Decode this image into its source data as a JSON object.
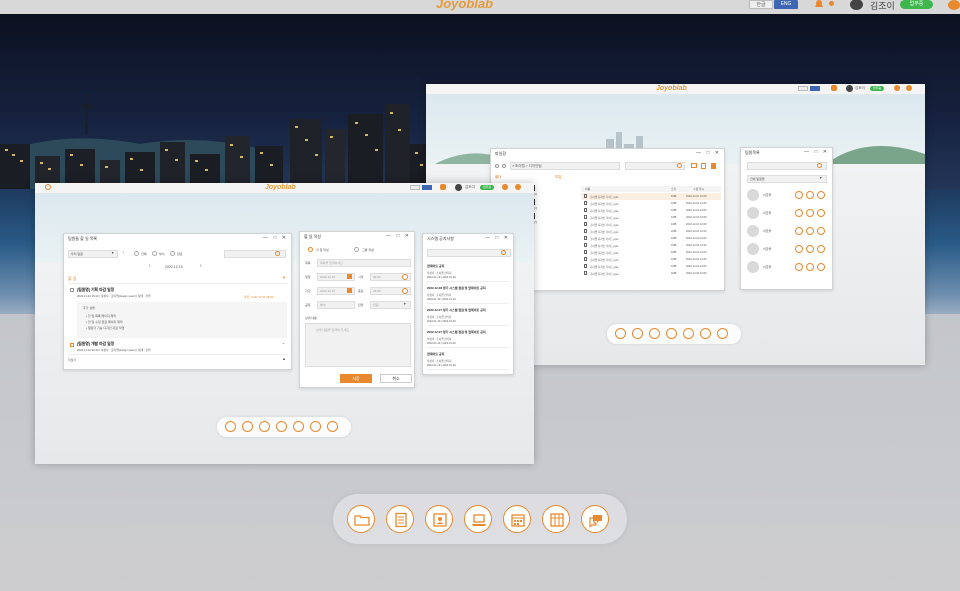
{
  "topbar": {
    "brand": "Joyoblab",
    "lang_ko": "한글",
    "lang_en": "ENG",
    "user_name": "김조이",
    "status": "업무중"
  },
  "colors": {
    "accent": "#e8892e",
    "status_green": "#3eb54d",
    "lang_active": "#3d67b4"
  },
  "dock": {
    "items": [
      "folder-icon",
      "document-list-icon",
      "contact-card-icon",
      "laptop-icon",
      "calendar-icon",
      "table-icon",
      "chat-bubbles-icon"
    ]
  },
  "left_window": {
    "brand": "Joyoblab",
    "user_name": "김조이",
    "status": "업무중",
    "schedule_panel": {
      "title": "팀원들 할 일 목록",
      "filter_value": "우리 팀원",
      "radio_all": "전체",
      "radio_mine": "부서",
      "radio_done": "완료",
      "date": "2022.12.15",
      "section_label": "할 일",
      "item1_title": "[팀원명] 기획 마감 일정",
      "item1_meta": "2022.11.23 15:23  |  작성자 : 조이랩(design team)  |  상태 : 진행",
      "item1_due": "마감 : 2022.12.31 18:00",
      "item1_body_title": "추가 설명",
      "item1_b1": "할 일 목록 페이지 제작",
      "item1_b2": "할 일 수정·완료 페이지 제작",
      "item1_b3": "캘린더 기능 디자인 자료 작업",
      "item2_title": "[팀원명] 개발 마감 일정",
      "item2_meta": "2022.11.24 10:30  |  작성자 : 조이랩(design team)  |  상태 : 진행",
      "footer_label": "더보기"
    },
    "add_task_panel": {
      "title": "할 일 작성",
      "tab_personal": "할 일 작성",
      "tab_team": "그룹 작성",
      "field_title_label": "제목",
      "field_title_placeholder": "제목을 입력하세요.",
      "start_label": "일정",
      "start_date": "2022-11-15",
      "start_time_label": "시작",
      "start_time": "09:00",
      "end_label": "기간",
      "end_date": "2022-11-15",
      "end_time_label": "종료",
      "end_time": "18:00",
      "share_label": "공유",
      "share_value": "부서",
      "assign_label": "담당",
      "assign_value": "전원",
      "detail_label": "상세 내용",
      "detail_placeholder": "상세 내용을 입력해 주세요.",
      "save": "저장",
      "cancel": "취소"
    },
    "notice_panel": {
      "title": "시스템 공지사항",
      "items": [
        {
          "title": "업데이트 공지",
          "sub": "작성자 : 조이랩 관리자",
          "date": "2022-01-19  |  2022-01-20"
        },
        {
          "title": "2022.12.28 정기 시스템 점검 및 업데이트 공지",
          "sub": "작성자 : 조이랩 관리자",
          "date": "2022-01-19  |  2022-01-20"
        },
        {
          "title": "2022.12.27 정기 시스템 점검 및 업데이트 공지",
          "sub": "작성자 : 조이랩 관리자",
          "date": "2022-01-19  |  2022-01-20"
        },
        {
          "title": "2022.12.27 정기 시스템 점검 및 업데이트 공지",
          "sub": "작성자 : 조이랩 관리자",
          "date": "2022-01-19  |  2022-01-20"
        },
        {
          "title": "업데이트 공지",
          "sub": "작성자 : 조이랩 관리자",
          "date": "2022-01-19  |  2022-01-20"
        }
      ]
    }
  },
  "right_window": {
    "brand": "Joyoblab",
    "user_name": "김조이",
    "status": "업무중",
    "files_panel": {
      "title": "파일함",
      "path": "> 조이랩 > 디자인팀",
      "folder_label": "폴더",
      "list_label": "파일",
      "col_name": "이름",
      "col_size": "크기",
      "col_date": "수정 일시",
      "files": [
        {
          "name": "조이랩 디자인 가이드.pptx",
          "size": "1MB",
          "date": "2022-12-01 12:00"
        },
        {
          "name": "조이랩 디자인 가이드.pptx",
          "size": "1MB",
          "date": "2022-12-01 12:00"
        },
        {
          "name": "조이랩 디자인 가이드.pptx",
          "size": "1MB",
          "date": "2022-12-01 12:00"
        },
        {
          "name": "조이랩 디자인 가이드.pptx",
          "size": "1MB",
          "date": "2022-12-01 12:00"
        },
        {
          "name": "조이랩 디자인 가이드.pptx",
          "size": "1MB",
          "date": "2022-12-01 12:00"
        },
        {
          "name": "조이랩 디자인 가이드.pptx",
          "size": "1MB",
          "date": "2022-12-01 12:00"
        },
        {
          "name": "조이랩 디자인 가이드.pptx",
          "size": "1MB",
          "date": "2022-12-01 12:00"
        },
        {
          "name": "조이랩 디자인 가이드.pptx",
          "size": "1MB",
          "date": "2022-12-01 12:00"
        },
        {
          "name": "조이랩 디자인 가이드.pptx",
          "size": "1MB",
          "date": "2022-12-01 12:00"
        },
        {
          "name": "조이랩 디자인 가이드.pptx",
          "size": "1MB",
          "date": "2022-12-01 12:00"
        },
        {
          "name": "조이랩 디자인 가이드.pptx",
          "size": "1MB",
          "date": "2022-12-01 12:00"
        },
        {
          "name": "조이랩 디자인 가이드.pptx",
          "size": "1MB",
          "date": "2022-12-01 12:00"
        }
      ],
      "folders": [
        "디자인 폴더",
        "디자인 폴더",
        "디자인 폴더",
        "디자인 폴더",
        "디자인 폴더",
        "디자인 폴더",
        "디자인 폴더",
        "디자인 폴더",
        "디자인 폴더"
      ]
    },
    "members_panel": {
      "title": "팀원목록",
      "filter_value": "전체 팀원들",
      "members": [
        "이한울",
        "이한울",
        "이한울",
        "이한울",
        "이한울"
      ]
    }
  }
}
